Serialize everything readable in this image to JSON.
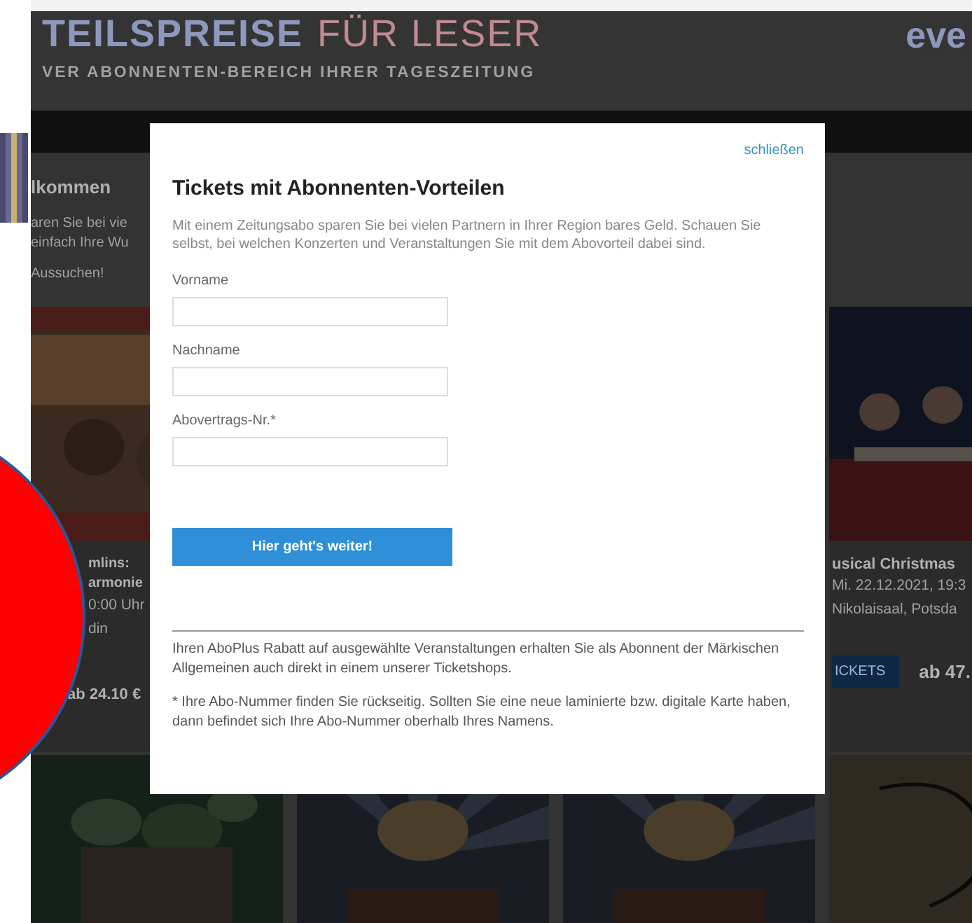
{
  "header": {
    "title_main": "TEILSPREISE",
    "title_accent": "FÜR LESER",
    "subtitle": "VER ABONNENTEN-BEREICH IHRER TAGESZEITUNG",
    "brand": "eve"
  },
  "intro": {
    "heading": "lkommen",
    "lines": [
      "aren Sie bei vie",
      "einfach Ihre Wu"
    ],
    "link": "Aussuchen!"
  },
  "events": [
    {
      "title_lines": [
        "mlins:",
        "armonie"
      ],
      "date": "0:00 Uhr",
      "venue": "din",
      "price": "ab 24.10 €"
    },
    {
      "title_lines": [
        "usical Christmas"
      ],
      "date": "Mi. 22.12.2021, 19:3",
      "venue": "Nikolaisaal, Potsda",
      "button": "ICKETS",
      "price": "ab 47."
    }
  ],
  "modal": {
    "close": "schließen",
    "title": "Tickets mit Abonnenten-Vorteilen",
    "intro": "Mit einem Zeitungsabo sparen Sie bei vielen Partnern in Ihrer Region bares Geld. Schauen Sie selbst, bei welchen Konzerten und Veranstaltungen Sie mit dem Abovorteil dabei sind.",
    "fields": [
      {
        "label": "Vorname"
      },
      {
        "label": "Nachname"
      },
      {
        "label": "Abovertrags-Nr.*"
      }
    ],
    "submit": "Hier geht's weiter!",
    "notes": [
      "Ihren AboPlus Rabatt auf ausgewählte Veranstaltungen erhalten Sie als Abonnent der Märkischen Allgemeinen auch direkt in einem unserer Ticketshops.",
      "* Ihre Abo-Nummer finden Sie rückseitig. Sollten Sie eine neue laminierte bzw. digitale Karte haben, dann befindet sich Ihre Abo-Nummer oberhalb Ihres Namens."
    ]
  }
}
